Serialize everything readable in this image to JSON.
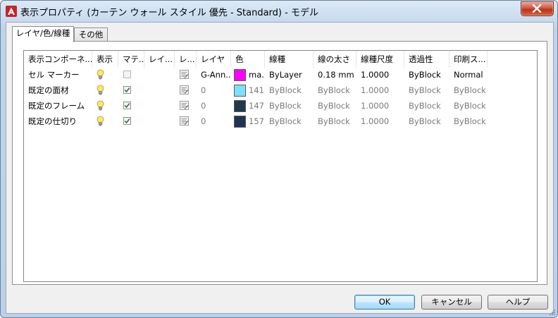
{
  "window": {
    "title": "表示プロパティ (カーテン ウォール スタイル 優先 - Standard) - モデル"
  },
  "tabs": [
    {
      "label": "レイヤ/色/線種",
      "active": true
    },
    {
      "label": "その他",
      "active": false
    }
  ],
  "grid": {
    "columns": [
      "表示コンポーネ...",
      "表示",
      "マテ...",
      "レイ...",
      "レ...",
      "レイヤ",
      "色",
      "線種",
      "線の太さ",
      "線種尺度",
      "透過性",
      "印刷ス..."
    ],
    "rows": [
      {
        "component": "セル マーカー",
        "visible": true,
        "material": false,
        "material_enabled": false,
        "layer": "G-Ann...",
        "color_label": "ma...",
        "color_hex": "#ff00ff",
        "linetype": "ByLayer",
        "lineweight": "0.18 mm",
        "ltscale": "1.0000",
        "transparency": "ByBlock",
        "plotstyle": "Normal",
        "greyed": false
      },
      {
        "component": "既定の面材",
        "visible": true,
        "material": true,
        "material_enabled": true,
        "layer": "0",
        "color_label": "141",
        "color_hex": "#7fdfff",
        "linetype": "ByBlock",
        "lineweight": "ByBlock",
        "ltscale": "1.0000",
        "transparency": "ByBlock",
        "plotstyle": "ByBlock",
        "greyed": true
      },
      {
        "component": "既定のフレーム",
        "visible": true,
        "material": true,
        "material_enabled": true,
        "layer": "0",
        "color_label": "147",
        "color_hex": "#1f3a4d",
        "linetype": "ByBlock",
        "lineweight": "ByBlock",
        "ltscale": "1.0000",
        "transparency": "ByBlock",
        "plotstyle": "ByBlock",
        "greyed": true
      },
      {
        "component": "既定の仕切り",
        "visible": true,
        "material": true,
        "material_enabled": true,
        "layer": "0",
        "color_label": "157",
        "color_hex": "#1f3450",
        "linetype": "ByBlock",
        "lineweight": "ByBlock",
        "ltscale": "1.0000",
        "transparency": "ByBlock",
        "plotstyle": "ByBlock",
        "greyed": true
      }
    ]
  },
  "buttons": {
    "ok": "OK",
    "cancel": "キャンセル",
    "help": "ヘルプ"
  },
  "icons": {
    "app": "autocad-a-icon",
    "close": "close-icon",
    "visible": "lightbulb-icon",
    "layer_doc": "document-icon"
  }
}
